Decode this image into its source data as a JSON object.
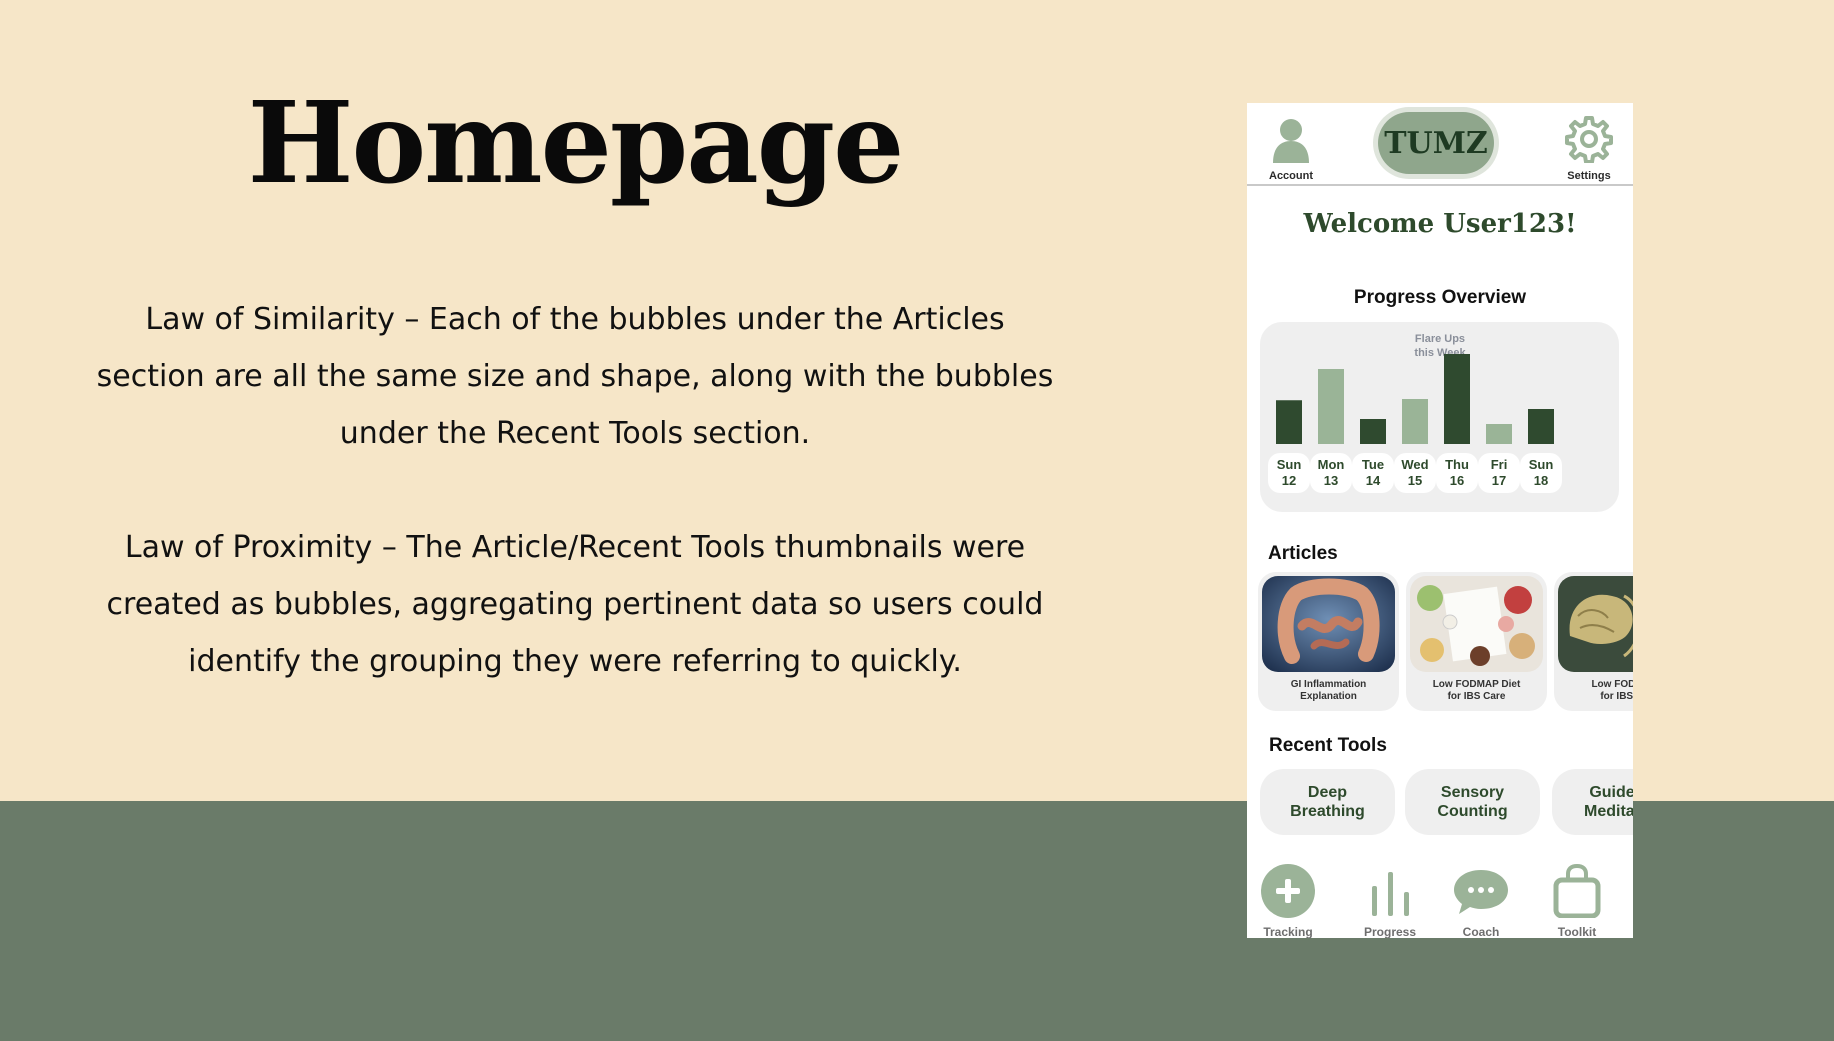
{
  "slide": {
    "title": "Homepage",
    "paragraph_1": "Law of Similarity – Each of the bubbles under the Articles section are all the same size and shape, along with the bubbles under the Recent Tools section.",
    "paragraph_2": "Law of Proximity – The Article/Recent Tools thumbnails were created as bubbles, aggregating pertinent data so users could identify the grouping they were referring to quickly."
  },
  "colors": {
    "background": "#f6e6c8",
    "band": "#6a7b69",
    "dark_green": "#2f4a2f",
    "light_green": "#9ab497",
    "icon_green": "#9bb398"
  },
  "app": {
    "header": {
      "account_label": "Account",
      "logo_text": "TUMZ",
      "settings_label": "Settings"
    },
    "welcome": "Welcome User123!",
    "progress": {
      "title": "Progress Overview",
      "chart_caption_line1": "Flare Ups",
      "chart_caption_line2": "this Week",
      "days": [
        {
          "name": "Sun",
          "date": "12"
        },
        {
          "name": "Mon",
          "date": "13"
        },
        {
          "name": "Tue",
          "date": "14"
        },
        {
          "name": "Wed",
          "date": "15"
        },
        {
          "name": "Thu",
          "date": "16"
        },
        {
          "name": "Fri",
          "date": "17"
        },
        {
          "name": "Sun",
          "date": "18"
        }
      ]
    },
    "articles": {
      "title": "Articles",
      "items": [
        {
          "line1": "GI Inflammation",
          "line2": "Explanation"
        },
        {
          "line1": "Low FODMAP Diet",
          "line2": "for IBS Care"
        },
        {
          "line1": "Low FODMAP",
          "line2": "for IBS Ca"
        }
      ]
    },
    "tools": {
      "title": "Recent Tools",
      "items": [
        {
          "line1": "Deep",
          "line2": "Breathing"
        },
        {
          "line1": "Sensory",
          "line2": "Counting"
        },
        {
          "line1": "Guide",
          "line2": "Medita"
        }
      ]
    },
    "bottom_nav": {
      "tracking": "Tracking",
      "progress": "Progress",
      "coach": "Coach",
      "toolkit": "Toolkit"
    }
  },
  "chart_data": {
    "type": "bar",
    "title": "Flare Ups this Week",
    "categories": [
      "Sun 12",
      "Mon 13",
      "Tue 14",
      "Wed 15",
      "Thu 16",
      "Fri 17",
      "Sun 18"
    ],
    "values": [
      3.5,
      6,
      2,
      3.6,
      7.2,
      1.6,
      2.8
    ],
    "bar_colors": [
      "#2f4a2f",
      "#9ab497",
      "#2f4a2f",
      "#9ab497",
      "#2f4a2f",
      "#9ab497",
      "#2f4a2f"
    ],
    "ylim": [
      0,
      8
    ],
    "grid": false
  }
}
